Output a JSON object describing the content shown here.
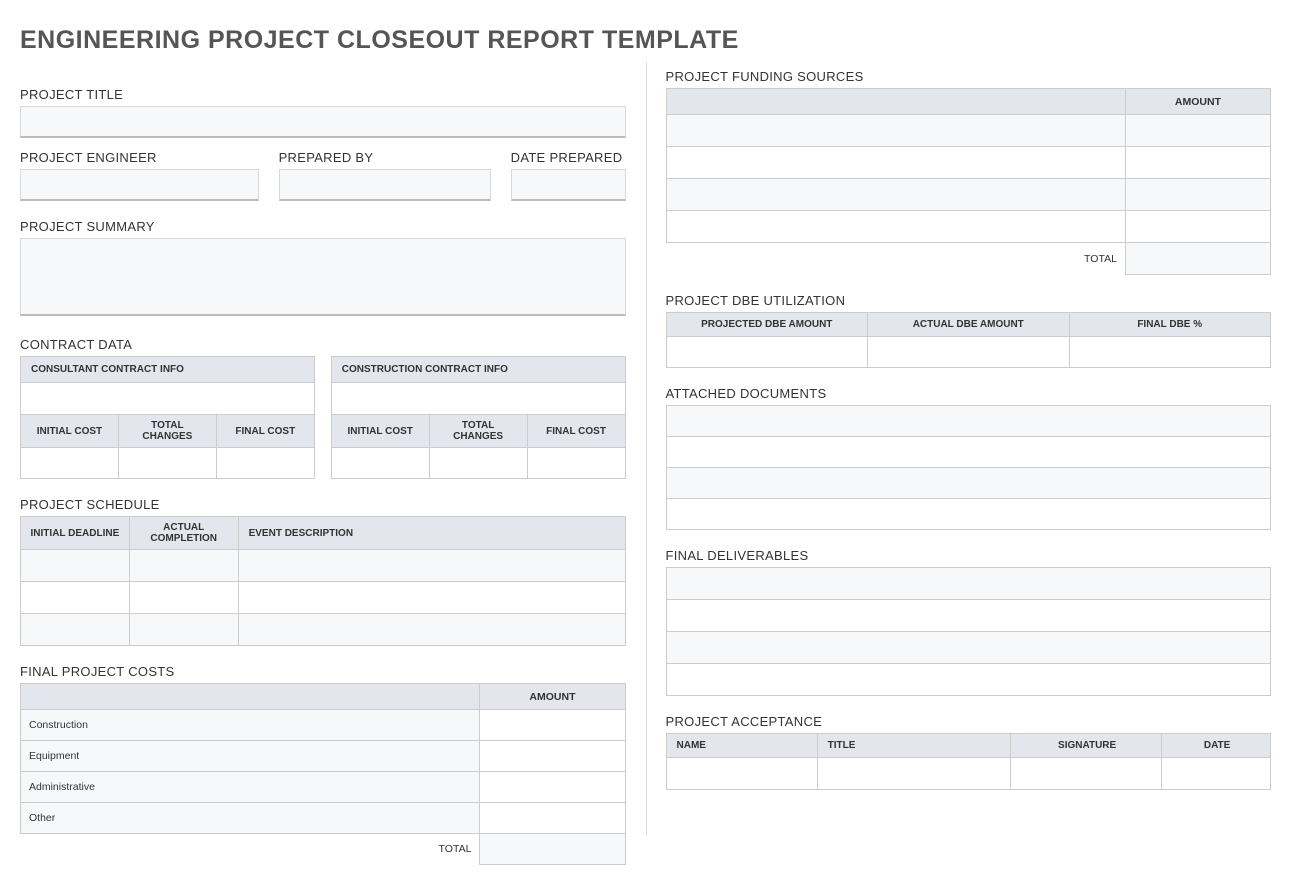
{
  "title": "ENGINEERING PROJECT CLOSEOUT REPORT TEMPLATE",
  "labels": {
    "project_title": "PROJECT TITLE",
    "project_engineer": "PROJECT ENGINEER",
    "prepared_by": "PREPARED BY",
    "date_prepared": "DATE PREPARED",
    "project_summary": "PROJECT SUMMARY",
    "contract_data": "CONTRACT DATA",
    "consultant_contract_info": "CONSULTANT CONTRACT INFO",
    "construction_contract_info": "CONSTRUCTION CONTRACT INFO",
    "initial_cost": "INITIAL COST",
    "total_changes": "TOTAL CHANGES",
    "final_cost": "FINAL COST",
    "project_schedule": "PROJECT SCHEDULE",
    "initial_deadline": "INITIAL DEADLINE",
    "actual_completion": "ACTUAL COMPLETION",
    "event_description": "EVENT DESCRIPTION",
    "final_project_costs": "FINAL PROJECT COSTS",
    "amount": "AMOUNT",
    "total": "TOTAL",
    "project_funding_sources": "PROJECT FUNDING SOURCES",
    "project_dbe_utilization": "PROJECT DBE UTILIZATION",
    "projected_dbe_amount": "PROJECTED DBE AMOUNT",
    "actual_dbe_amount": "ACTUAL DBE AMOUNT",
    "final_dbe_pct": "FINAL DBE %",
    "attached_documents": "ATTACHED DOCUMENTS",
    "final_deliverables": "FINAL DELIVERABLES",
    "project_acceptance": "PROJECT ACCEPTANCE",
    "name": "NAME",
    "title_col": "TITLE",
    "signature": "SIGNATURE",
    "date": "DATE"
  },
  "final_costs": {
    "rows": [
      "Construction",
      "Equipment",
      "Administrative",
      "Other"
    ]
  }
}
